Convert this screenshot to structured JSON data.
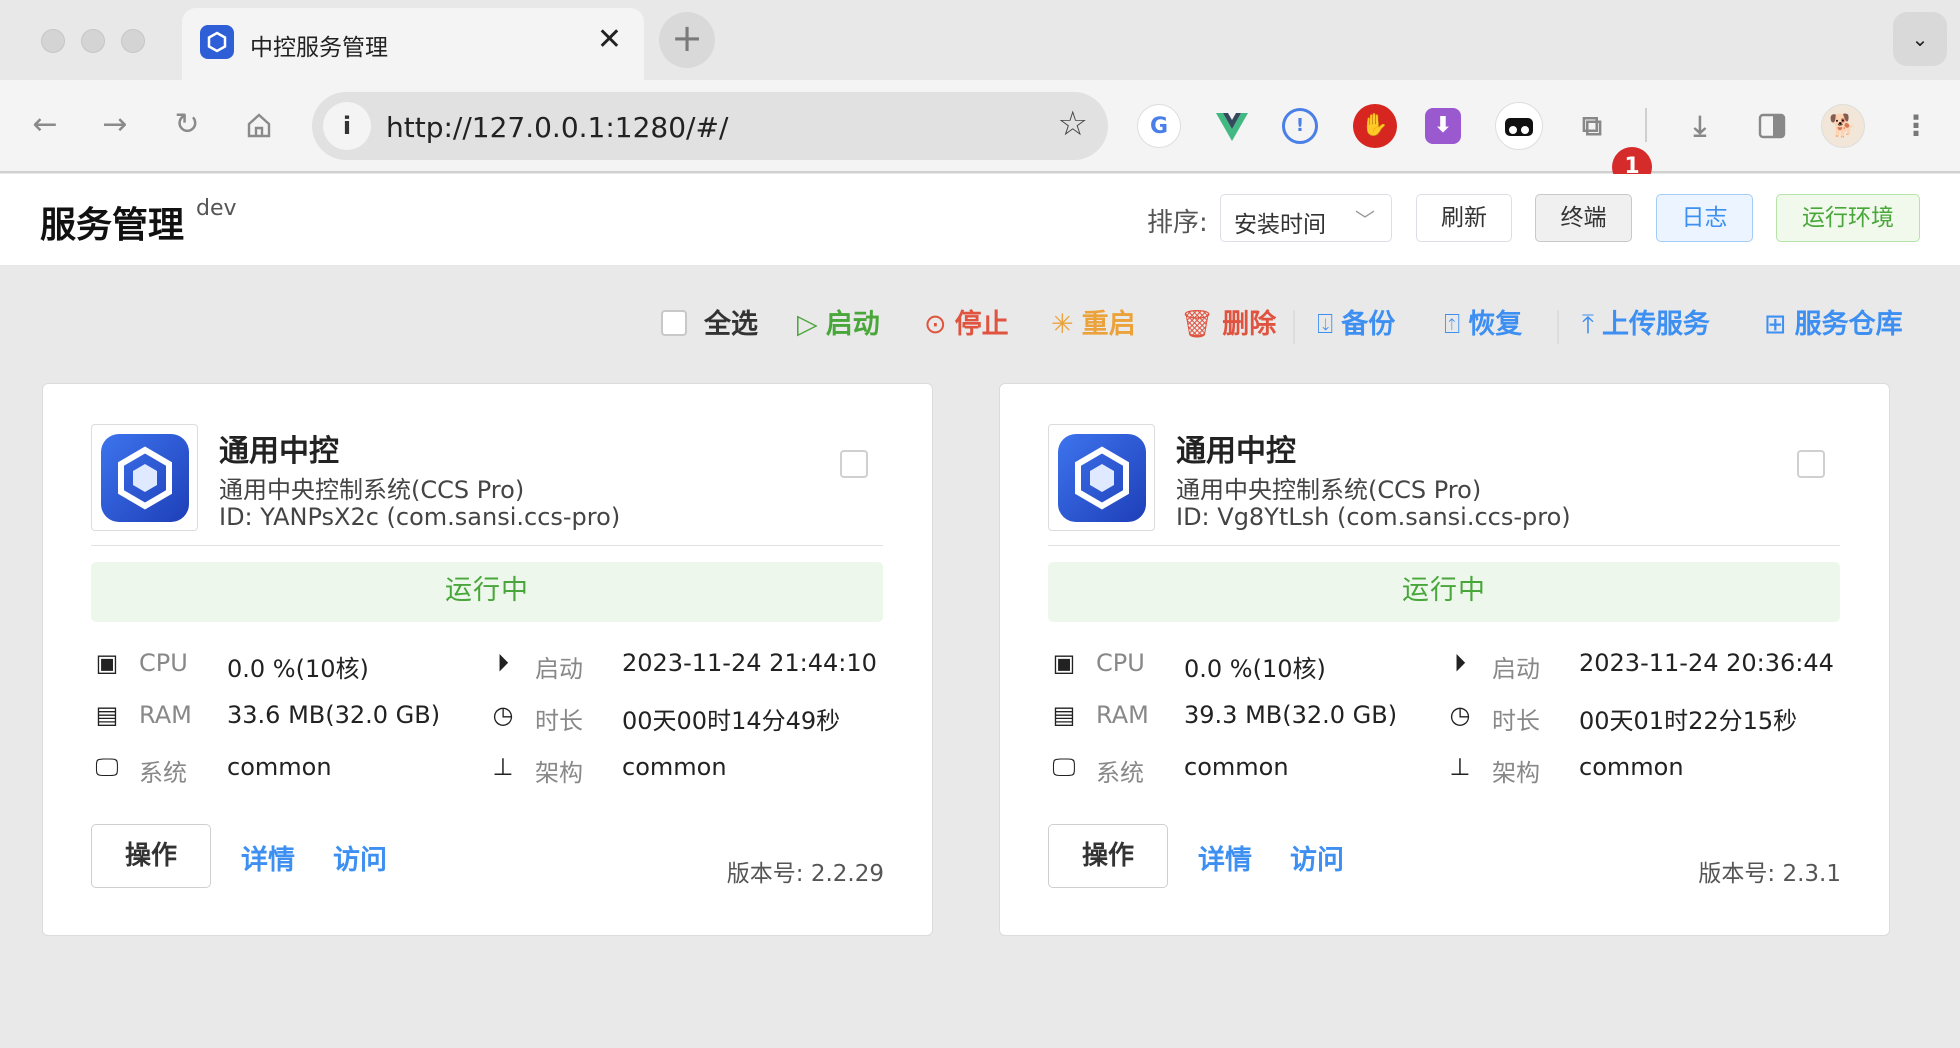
{
  "browser": {
    "tab_title": "中控服务管理",
    "tab_close": "✕",
    "new_tab": "+",
    "tab_menu": "⌄",
    "url": "http://127.0.0.1:1280/#/",
    "extension_badge": "1"
  },
  "header": {
    "title": "服务管理",
    "env": "dev",
    "sort_label": "排序:",
    "sort_value": "安装时间",
    "buttons": {
      "refresh": "刷新",
      "terminal": "终端",
      "logs": "日志",
      "runtime": "运行环境"
    }
  },
  "actions": {
    "select_all": "全选",
    "start": "启动",
    "stop": "停止",
    "restart": "重启",
    "delete": "删除",
    "backup": "备份",
    "restore": "恢复",
    "upload": "上传服务",
    "repository": "服务仓库"
  },
  "labels": {
    "cpu": "CPU",
    "ram": "RAM",
    "system": "系统",
    "start": "启动",
    "duration": "时长",
    "arch": "架构",
    "operate": "操作",
    "details": "详情",
    "visit": "访问"
  },
  "colors": {
    "green": "#49a63a",
    "red": "#e0533f",
    "orange": "#eba23a",
    "blue": "#3d8ff2"
  },
  "services": [
    {
      "name": "通用中控",
      "description": "通用中央控制系统(CCS Pro)",
      "id_line": "ID: YANPsX2c (com.sansi.ccs-pro)",
      "status": "运行中",
      "cpu": "0.0 %(10核)",
      "ram": "33.6 MB(32.0 GB)",
      "system": "common",
      "start_time": "2023-11-24 21:44:10",
      "duration": "00天00时14分49秒",
      "arch": "common",
      "version": "版本号: 2.2.29"
    },
    {
      "name": "通用中控",
      "description": "通用中央控制系统(CCS Pro)",
      "id_line": "ID: Vg8YtLsh (com.sansi.ccs-pro)",
      "status": "运行中",
      "cpu": "0.0 %(10核)",
      "ram": "39.3 MB(32.0 GB)",
      "system": "common",
      "start_time": "2023-11-24 20:36:44",
      "duration": "00天01时22分15秒",
      "arch": "common",
      "version": "版本号: 2.3.1"
    }
  ]
}
